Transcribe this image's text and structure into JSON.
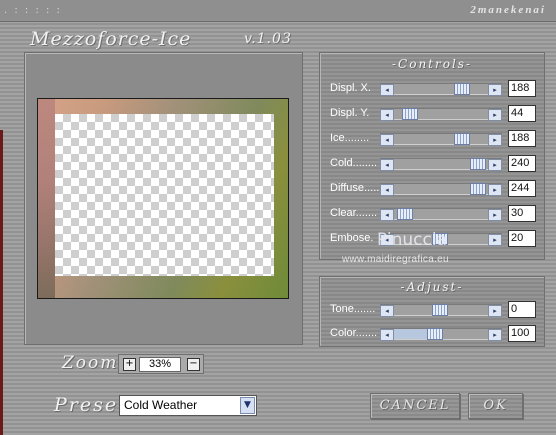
{
  "titlebar": {
    "dots": ". : : : : :",
    "brand": "2manekenai"
  },
  "app": {
    "title": "Mezzoforce-Ice",
    "version": "v.1.03"
  },
  "controls": {
    "title": "-Controls-",
    "rows": [
      {
        "label": "Displ. X.",
        "value": "188",
        "fraction": 0.737
      },
      {
        "label": "Displ. Y.",
        "value": "44",
        "fraction": 0.173
      },
      {
        "label": "Ice........",
        "value": "188",
        "fraction": 0.737
      },
      {
        "label": "Cold........",
        "value": "240",
        "fraction": 0.941
      },
      {
        "label": "Diffuse.....",
        "value": "244",
        "fraction": 0.957
      },
      {
        "label": "Clear.......",
        "value": "30",
        "fraction": 0.118
      },
      {
        "label": "Embose.",
        "value": "20",
        "fraction": 0.5
      }
    ]
  },
  "adjust": {
    "title": "-Adjust-",
    "rows": [
      {
        "label": "Tone.......",
        "value": "0",
        "fraction": 0.5
      },
      {
        "label": "Color.......",
        "value": "100",
        "fraction": 0.45
      }
    ]
  },
  "watermark": {
    "name": "Pinuccia",
    "url": "www.maidiregrafica.eu"
  },
  "zoom": {
    "label": "Zoom",
    "value": "33%",
    "plus": "+",
    "minus": "−"
  },
  "preset": {
    "label": "Preset",
    "value": "Cold Weather"
  },
  "buttons": {
    "cancel": "CANCEL",
    "ok": "OK"
  },
  "icons": {
    "left_arrow": "◂",
    "right_arrow": "▸",
    "dropdown": "▼"
  }
}
